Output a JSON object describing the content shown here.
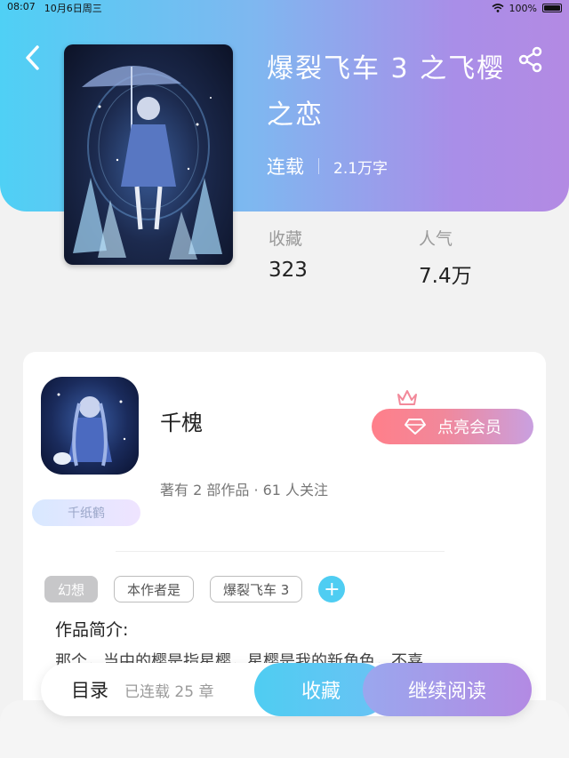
{
  "status_bar": {
    "time": "08:07",
    "date": "10月6日周三",
    "battery": "100%"
  },
  "book": {
    "title": "爆裂飞车 3 之飞樱之恋",
    "status": "连载",
    "word_count": "2.1万字",
    "favorites_label": "收藏",
    "favorites_value": "323",
    "popularity_label": "人气",
    "popularity_value": "7.4万"
  },
  "author": {
    "name": "千槐",
    "info": "著有 2 部作品 · 61 人关注",
    "badge": "千纸鹤",
    "vip_button": "点亮会员"
  },
  "tags": [
    "幻想",
    "本作者是",
    "爆裂飞车 3"
  ],
  "intro": {
    "title": "作品简介:",
    "text": "那个，当中的樱是指星樱，星樱是我的新角色，不喜"
  },
  "bottom_bar": {
    "toc_label": "目录",
    "toc_progress": "已连载 25 章",
    "favorite_button": "收藏",
    "read_button": "继续阅读"
  },
  "colors": {
    "accent_blue": "#4fcdf2",
    "accent_purple": "#b38ae3",
    "vip_pink": "#ff7f8a"
  },
  "icons": {
    "back": "back-arrow-icon",
    "share": "share-icon",
    "wifi": "wifi-icon",
    "crown": "crown-icon",
    "diamond": "diamond-icon",
    "add": "plus-icon"
  }
}
